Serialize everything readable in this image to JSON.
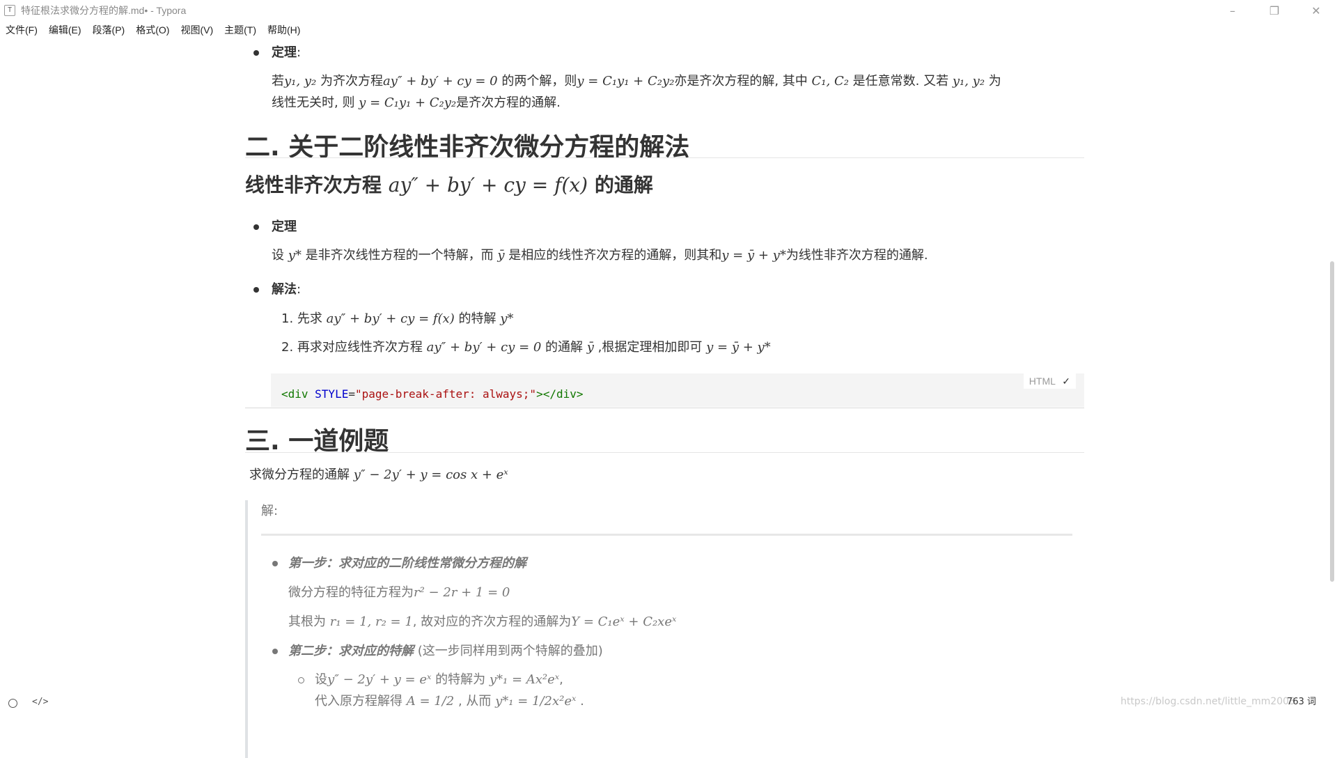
{
  "window": {
    "title": "特征根法求微分方程的解.md• - Typora",
    "icon": "typora-icon",
    "minimize": "–",
    "restore": "❐",
    "close": "✕"
  },
  "menu": [
    "文件(F)",
    "编辑(E)",
    "段落(P)",
    "格式(O)",
    "视图(V)",
    "主题(T)",
    "帮助(H)"
  ],
  "doc": {
    "theorem1_label": "定理",
    "theorem1_colon": ":",
    "theorem1_line1": {
      "t1": "若",
      "m1": "y₁, y₂",
      "t2": " 为齐次方程",
      "m2": "ay″ + by′ + cy = 0",
      "t3": " 的两个解，则",
      "m3": "y = C₁y₁ + C₂y₂",
      "t4": "亦是齐次方程的解, 其中 ",
      "m4": "C₁, C₂",
      "t5": " 是任意常数. 又若 ",
      "m5": "y₁, y₂",
      "t6": " 为"
    },
    "theorem1_line2": {
      "t1": "线性无关时, 则 ",
      "m1": "y = C₁y₁ + C₂y₂",
      "t2": "是齐次方程的通解."
    },
    "h2_section2": "二. 关于二阶线性非齐次微分方程的解法",
    "h3": {
      "t1": "线性非齐次方程 ",
      "m1": "ay″ + by′ + cy = f(x)",
      "t2": " 的通解"
    },
    "theorem2_label": "定理",
    "theorem2_line": {
      "t1": " 设 ",
      "m1": "y*",
      "t2": " 是非齐次线性方程的一个特解，而 ",
      "m2": "ȳ",
      "t3": " 是相应的线性齐次方程的通解，则其和",
      "m3": "y = ȳ + y*",
      "t4": "为线性非齐次方程的通解."
    },
    "method_label": "解法",
    "method_colon": ":",
    "step1": {
      "num": "1.",
      "t1": " 先求  ",
      "m1": "ay″ + by′ + cy = f(x)",
      "t2": "  的特解 ",
      "m2": "y*"
    },
    "step2": {
      "num": "2.",
      "t1": "  再求对应线性齐次方程 ",
      "m1": "ay″ + by′ + cy = 0",
      "t2": "  的通解 ",
      "m2": "ȳ",
      "t3": " ,根据定理相加即可 ",
      "m3": "y = ȳ + y*"
    },
    "code": {
      "lang": "HTML",
      "check": "✓",
      "open_tag": "<div",
      "attr": " STYLE",
      "eq": "=",
      "str": "\"page-break-after: always;\"",
      "close": "></div>"
    },
    "h2_section3": "三. 一道例题",
    "problem": {
      "t1": "求微分方程的通解 ",
      "m1": "y″ − 2y′ + y = cos x + eˣ"
    },
    "solution_label": "解",
    "solution_colon": ":",
    "step_a_label": "第一步：求对应的二阶线性常微分方程的解",
    "char_eq": {
      "t1": "微分方程的特征方程为",
      "m1": "r² − 2r + 1 = 0"
    },
    "roots": {
      "t1": "其根为 ",
      "m1": "r₁ = 1, r₂ = 1",
      "t2": ", 故对应的齐次方程的通解为",
      "m2": "Y = C₁eˣ + C₂xeˣ"
    },
    "step_b_label": "第二步：求对应的特解",
    "step_b_note": " (这一步同样用到两个特解的叠加)",
    "sub1": {
      "t1": "设",
      "m1": "y″ − 2y′ + y = eˣ",
      "t2": " 的特解为 ",
      "m2": "y*₁ = Ax²eˣ",
      "t3": ","
    },
    "sub2": {
      "t1": "代入原方程解得 ",
      "m1": "A = 1/2",
      "t2": " , 从而 ",
      "m2": "y*₁ = 1/2x²eˣ",
      "t3": " ."
    }
  },
  "status": {
    "word_count": "763 词",
    "watermark": "https://blog.csdn.net/little_mm2003"
  }
}
